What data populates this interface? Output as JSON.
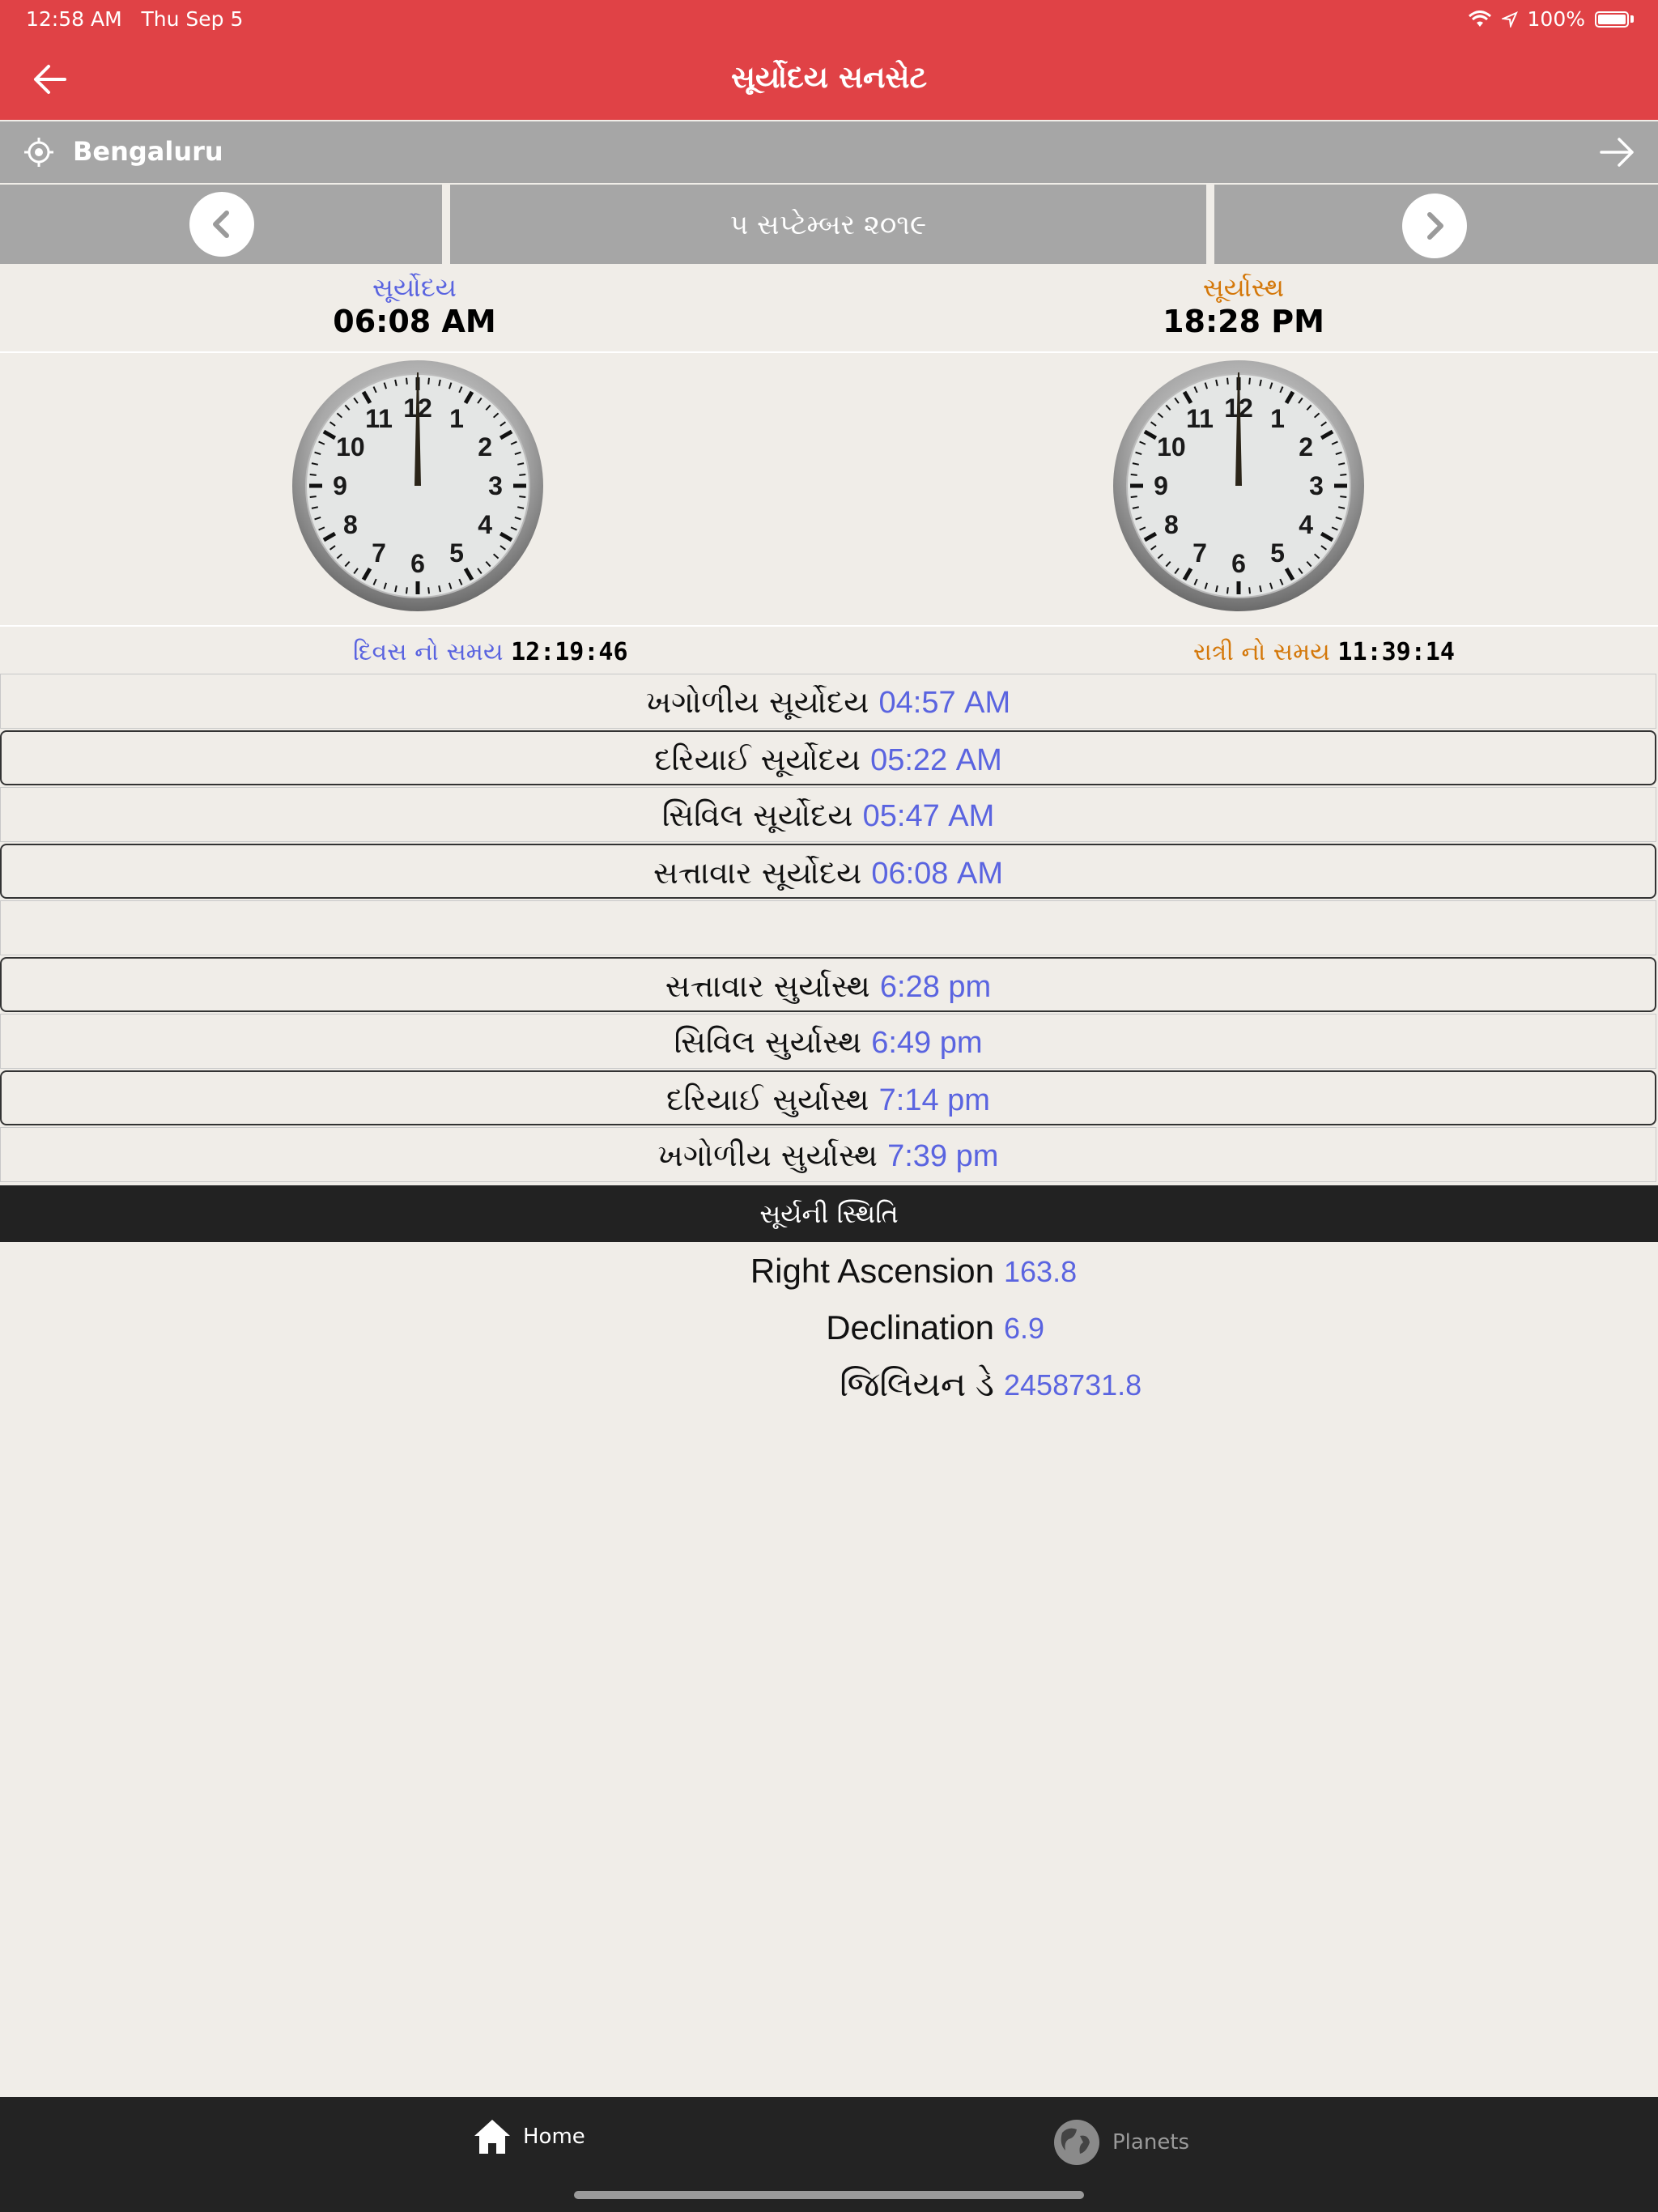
{
  "status_bar": {
    "time": "12:58 AM",
    "date": "Thu Sep 5",
    "battery": "100%"
  },
  "header": {
    "title": "સૂર્યોદય સનસેટ"
  },
  "location": {
    "name": "Bengaluru"
  },
  "date_nav": {
    "date": "૫ સપ્ટેમ્બર ૨૦૧૯"
  },
  "sunrise": {
    "label": "સૂર્યોદય",
    "time": "06:08 AM"
  },
  "sunset": {
    "label": "સૂર્યાસ્થ",
    "time": "18:28 PM"
  },
  "day_length": {
    "label": "દિવસ નો સમય",
    "value": "12:19:46"
  },
  "night_length": {
    "label": "રાત્રી નો સમય",
    "value": "11:39:14"
  },
  "times": [
    {
      "label": "ખગોળીય સૂર્યોદય",
      "value": "04:57 AM"
    },
    {
      "label": "દરિયાઈ સૂર્યોદય",
      "value": "05:22 AM"
    },
    {
      "label": "સિવિલ સૂર્યોદય",
      "value": "05:47 AM"
    },
    {
      "label": "સત્તાવાર સૂર્યોદય",
      "value": "06:08 AM"
    },
    {
      "label": "સત્તાવાર સુર્યાસ્થ",
      "value": "6:28 pm"
    },
    {
      "label": "સિવિલ સુર્યાસ્થ",
      "value": "6:49 pm"
    },
    {
      "label": "દરિયાઈ સુર્યાસ્થ",
      "value": "7:14 pm"
    },
    {
      "label": "ખગોળીય સુર્યાસ્થ",
      "value": "7:39 pm"
    }
  ],
  "sun_position": {
    "header": "સૂર્યની સ્થિતિ",
    "right_ascension": {
      "label": "Right Ascension",
      "value": "163.8"
    },
    "declination": {
      "label": "Declination",
      "value": "6.9"
    },
    "julian_day": {
      "label": "જિલિયન ડે",
      "value": "2458731.8"
    }
  },
  "tabs": {
    "home": "Home",
    "planets": "Planets"
  },
  "clock_numbers": [
    "12",
    "1",
    "2",
    "3",
    "4",
    "5",
    "6",
    "7",
    "8",
    "9",
    "10",
    "11"
  ],
  "colors": {
    "accent": "#e04246",
    "value_blue": "#5a64e0",
    "sunset_orange": "#d4780a"
  }
}
